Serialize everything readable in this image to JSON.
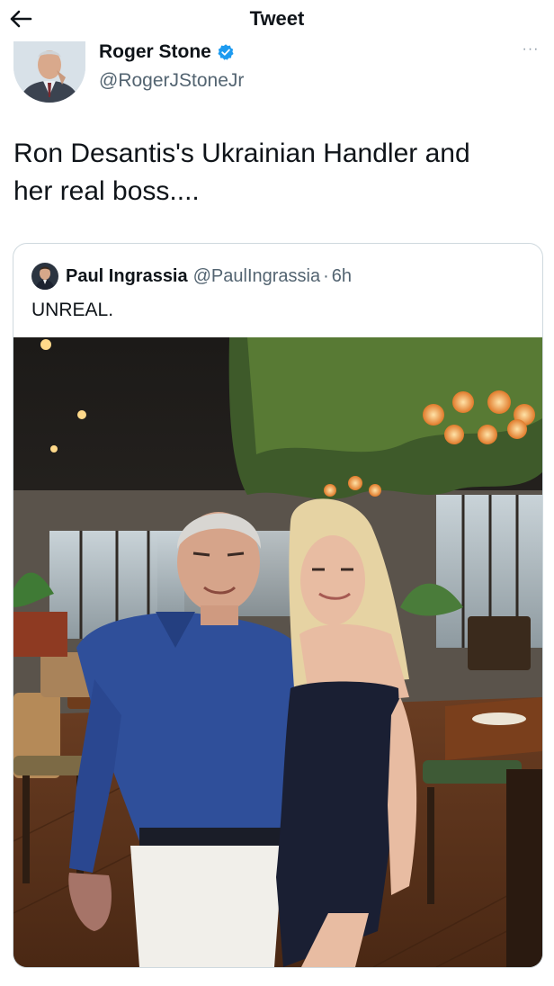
{
  "header": {
    "title": "Tweet"
  },
  "tweet": {
    "author_name": "Roger Stone",
    "author_handle": "@RogerJStoneJr",
    "text_line1": "Ron Desantis's Ukrainian Handler and",
    "text_line2": "her real boss....",
    "more_label": "···"
  },
  "quoted_tweet": {
    "author_name": "Paul Ingrassia",
    "author_handle": "@PaulIngrassia",
    "separator": "·",
    "time": "6h",
    "text": "UNREAL."
  },
  "colors": {
    "verified_blue": "#1d9bf0",
    "secondary_text": "#536471",
    "border": "#cfd9de",
    "shirt_blue": "#2f4f9a",
    "dress_navy": "#1a1f33"
  },
  "icons": {
    "back": "arrow-left-icon",
    "verified": "verified-badge-icon",
    "more": "more-dots-icon"
  }
}
